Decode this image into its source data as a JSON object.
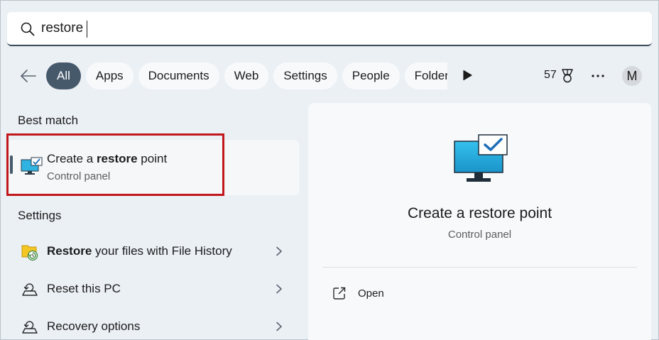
{
  "search": {
    "value": "restore",
    "icon": "search-icon"
  },
  "filters": {
    "back_icon": "back-arrow-icon",
    "tabs": [
      {
        "label": "All",
        "active": true
      },
      {
        "label": "Apps"
      },
      {
        "label": "Documents"
      },
      {
        "label": "Web"
      },
      {
        "label": "Settings"
      },
      {
        "label": "People"
      },
      {
        "label": "Folders"
      }
    ],
    "more_tabs_icon": "play-icon",
    "points": "57",
    "points_icon": "medal-icon",
    "more_icon": "more-horizontal-icon",
    "avatar_initial": "M"
  },
  "best_match": {
    "section_label": "Best match",
    "title_pre": "Create a ",
    "title_bold": "restore",
    "title_post": " point",
    "subtitle": "Control panel",
    "icon": "monitor-check-icon"
  },
  "settings": {
    "section_label": "Settings",
    "items": [
      {
        "label_bold": "Restore",
        "label_rest": " your files with File History",
        "icon": "file-history-icon"
      },
      {
        "label_bold": "",
        "label_rest": "Reset this PC",
        "icon": "reset-pc-icon"
      },
      {
        "label_bold": "",
        "label_rest": "Recovery options",
        "icon": "recovery-icon"
      }
    ]
  },
  "preview": {
    "title": "Create a restore point",
    "subtitle": "Control panel",
    "actions": [
      {
        "label": "Open",
        "icon": "open-external-icon"
      }
    ]
  },
  "colors": {
    "background": "#ebf0f5",
    "active_chip": "#46596b",
    "highlight": "#c0161c",
    "monitor": "#29a9d6"
  }
}
